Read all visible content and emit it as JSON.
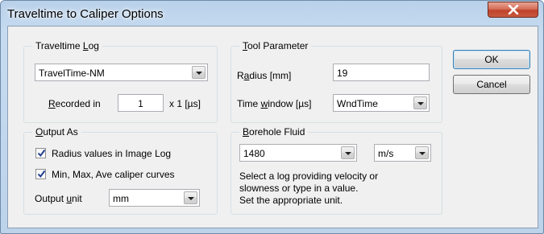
{
  "window": {
    "title": "Traveltime to Caliper Options"
  },
  "traveltime_log": {
    "group_title_pre": "Traveltime ",
    "group_title_u": "L",
    "group_title_post": "og",
    "log_value": "TravelTime-NM",
    "recorded_in_u": "R",
    "recorded_in_post": "ecorded in",
    "recorded_in_value": "1",
    "recorded_in_unit": "x 1 [µs]"
  },
  "tool_parameter": {
    "group_title_u": "T",
    "group_title_post": "ool Parameter",
    "radius_pre": "R",
    "radius_u": "a",
    "radius_post": "dius [mm]",
    "radius_value": "19",
    "time_window_pre": "Time ",
    "time_window_u": "w",
    "time_window_post": "indow [µs]",
    "time_window_value": "WndTime"
  },
  "output_as": {
    "group_title_u": "O",
    "group_title_post": "utput As",
    "radius_values_label": "Radius values in Image Log",
    "radius_values_checked": true,
    "caliper_curves_label": "Min, Max, Ave caliper curves",
    "caliper_curves_checked": true,
    "output_unit_pre": "Output ",
    "output_unit_u": "u",
    "output_unit_post": "nit",
    "output_unit_value": "mm"
  },
  "borehole_fluid": {
    "group_title_u": "B",
    "group_title_post": "orehole Fluid",
    "velocity_value": "1480",
    "unit_value": "m/s",
    "help_line1": "Select a log providing velocity or",
    "help_line2": "slowness or type in a value.",
    "help_line3": "Set the appropriate unit."
  },
  "buttons": {
    "ok": "OK",
    "cancel": "Cancel"
  }
}
